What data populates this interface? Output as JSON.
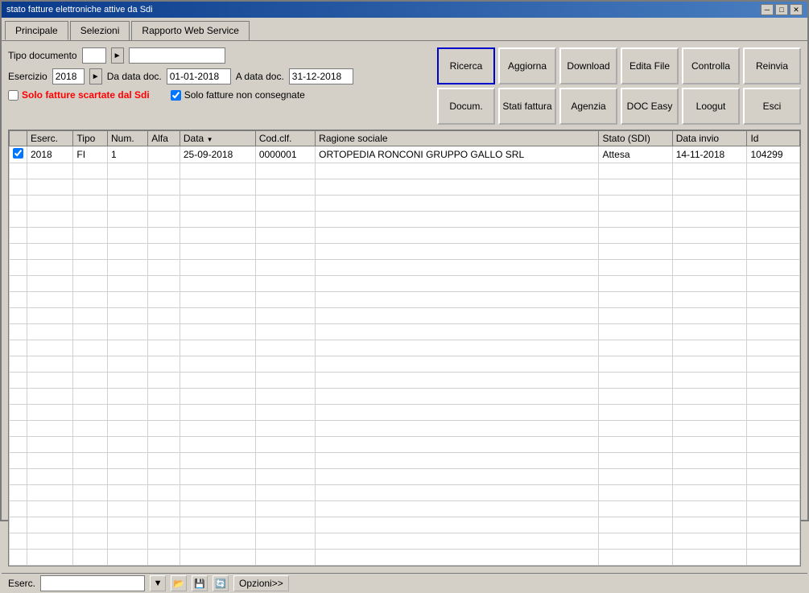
{
  "window": {
    "title": "stato fatture elettroniche attive da Sdi",
    "minimize": "─",
    "maximize": "□",
    "close": "✕"
  },
  "tabs": [
    {
      "label": "Principale",
      "active": true
    },
    {
      "label": "Selezioni",
      "active": false
    },
    {
      "label": "Rapporto Web Service",
      "active": false
    }
  ],
  "form": {
    "tipo_doc_label": "Tipo documento",
    "tipo_doc_value": "",
    "esercizio_label": "Esercizio",
    "esercizio_value": "2018",
    "da_data_label": "Da data doc.",
    "da_data_value": "01-01-2018",
    "a_data_label": "A data doc.",
    "a_data_value": "31-12-2018",
    "solo_scartate_label": "Solo fatture scartate dal Sdi",
    "solo_non_consegnate_label": "Solo fatture non consegnate"
  },
  "buttons": {
    "row1": [
      {
        "label": "Ricerca",
        "name": "ricerca-button",
        "primary": true
      },
      {
        "label": "Aggiorna",
        "name": "aggiorna-button"
      },
      {
        "label": "Download",
        "name": "download-button"
      },
      {
        "label": "Edita File",
        "name": "edita-file-button"
      },
      {
        "label": "Controlla",
        "name": "controlla-button"
      },
      {
        "label": "Reinvia",
        "name": "reinvia-button"
      }
    ],
    "row2": [
      {
        "label": "Docum.",
        "name": "docum-button"
      },
      {
        "label": "Stati fattura",
        "name": "stati-fattura-button"
      },
      {
        "label": "Agenzia",
        "name": "agenzia-button"
      },
      {
        "label": "DOC Easy",
        "name": "doc-easy-button"
      },
      {
        "label": "Loogut",
        "name": "loogut-button"
      },
      {
        "label": "Esci",
        "name": "esci-button"
      }
    ]
  },
  "table": {
    "columns": [
      {
        "key": "checkbox",
        "label": ""
      },
      {
        "key": "eserc",
        "label": "Eserc."
      },
      {
        "key": "tipo",
        "label": "Tipo"
      },
      {
        "key": "num",
        "label": "Num."
      },
      {
        "key": "alfa",
        "label": "Alfa"
      },
      {
        "key": "data",
        "label": "Data",
        "sort": true
      },
      {
        "key": "cod_clf",
        "label": "Cod.clf."
      },
      {
        "key": "ragione_sociale",
        "label": "Ragione sociale"
      },
      {
        "key": "stato_sdi",
        "label": "Stato (SDI)"
      },
      {
        "key": "data_invio",
        "label": "Data invio"
      },
      {
        "key": "id",
        "label": "Id"
      }
    ],
    "rows": [
      {
        "checkbox": true,
        "eserc": "2018",
        "tipo": "FI",
        "num": "1",
        "alfa": "",
        "data": "25-09-2018",
        "cod_clf": "0000001",
        "ragione_sociale": "ORTOPEDIA RONCONI GRUPPO GALLO SRL",
        "stato_sdi": "Attesa",
        "data_invio": "14-11-2018",
        "id": "104299"
      }
    ]
  },
  "statusbar": {
    "eserc_label": "Eserc.",
    "eserc_value": "",
    "opzioni_label": "Opzioni>>"
  },
  "icons": {
    "filter": "▼",
    "folder_open": "📂",
    "save": "💾",
    "refresh": "🔄",
    "arrow_right": "►"
  }
}
